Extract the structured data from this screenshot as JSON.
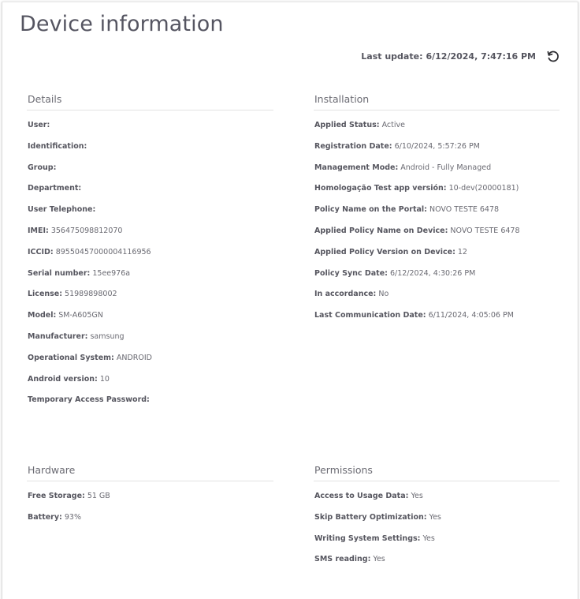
{
  "dialog": {
    "title": "Device information",
    "last_update_label": "Last update:",
    "last_update_value": "6/12/2024, 7:47:16 PM",
    "refresh_icon": "refresh-icon"
  },
  "details": {
    "title": "Details",
    "rows": [
      {
        "label": "User:",
        "value": ""
      },
      {
        "label": "Identification:",
        "value": ""
      },
      {
        "label": "Group:",
        "value": ""
      },
      {
        "label": "Department:",
        "value": ""
      },
      {
        "label": "User Telephone:",
        "value": ""
      },
      {
        "label": "IMEI:",
        "value": "356475098812070"
      },
      {
        "label": "ICCID:",
        "value": "89550457000004116956"
      },
      {
        "label": "Serial number:",
        "value": "15ee976a"
      },
      {
        "label": "License:",
        "value": "51989898002"
      },
      {
        "label": "Model:",
        "value": "SM-A605GN"
      },
      {
        "label": "Manufacturer:",
        "value": "samsung"
      },
      {
        "label": "Operational System:",
        "value": "ANDROID"
      },
      {
        "label": "Android version:",
        "value": "10"
      },
      {
        "label": "Temporary Access Password:",
        "value": ""
      }
    ]
  },
  "installation": {
    "title": "Installation",
    "rows": [
      {
        "label": "Applied Status:",
        "value": "Active"
      },
      {
        "label": "Registration Date:",
        "value": "6/10/2024, 5:57:26 PM"
      },
      {
        "label": "Management Mode:",
        "value": "Android - Fully Managed"
      },
      {
        "label": "Homologação Test app versión:",
        "value": "10-dev(20000181)"
      },
      {
        "label": "Policy Name on the Portal:",
        "value": "NOVO TESTE 6478"
      },
      {
        "label": "Applied Policy Name on Device:",
        "value": "NOVO TESTE 6478"
      },
      {
        "label": "Applied Policy Version on Device:",
        "value": "12"
      },
      {
        "label": "Policy Sync Date:",
        "value": "6/12/2024, 4:30:26 PM"
      },
      {
        "label": "In accordance:",
        "value": "No"
      },
      {
        "label": "Last Communication Date:",
        "value": "6/11/2024, 4:05:06 PM"
      }
    ]
  },
  "hardware": {
    "title": "Hardware",
    "rows": [
      {
        "label": "Free Storage:",
        "value": "51 GB"
      },
      {
        "label": "Battery:",
        "value": "93%"
      }
    ]
  },
  "permissions": {
    "title": "Permissions",
    "rows": [
      {
        "label": "Access to Usage Data:",
        "value": "Yes"
      },
      {
        "label": "Skip Battery Optimization:",
        "value": "Yes"
      },
      {
        "label": "Writing System Settings:",
        "value": "Yes"
      },
      {
        "label": "SMS reading:",
        "value": "Yes"
      }
    ]
  },
  "colors": {
    "text": "#56565f",
    "divider": "#e2e2e2"
  }
}
